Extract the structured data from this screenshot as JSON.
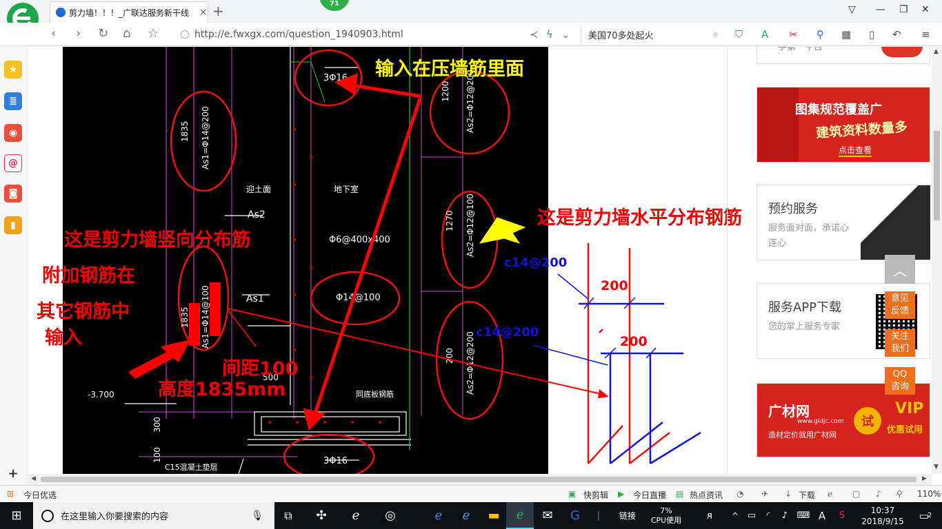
{
  "browser": {
    "tab_title": "剪力墙！！！_广联达服务新干线",
    "tab_close": "×",
    "new_tab": "+",
    "badge_count": "71",
    "url": "http://e.fwxgx.com/question_1940903.html",
    "search_text": "美国70多处起火",
    "accent_color": "#19a94a"
  },
  "cad": {
    "labels": {
      "top_3phi16": "3Φ16",
      "bottom_3phi16": "3Φ16",
      "as2_1200": "1200",
      "as2_phi12_top": "As2=Φ12@200",
      "as2_1270": "1270",
      "as2_phi12_mid": "As2=Φ12@100",
      "as2_200": "200",
      "as2_phi12_bot": "As2=Φ12@200",
      "as1_1835_top": "1835",
      "as1_phi14_top": "As1=Φ14@200",
      "as1_1835_bot": "1835",
      "as1_phi14_bot": "As1=Φ14@100",
      "yingtu": "迎土面",
      "dixiashi": "地下室",
      "as2_label": "As2",
      "as1_label": "As1",
      "phi6": "Φ6@400x400",
      "phi14_100": "Φ14@100",
      "elev": "-3.700",
      "dim_500": "500",
      "dim_300": "300",
      "dim_100": "100",
      "tongdi": "同底板钢筋",
      "c15": "C15混凝土垫层"
    }
  },
  "annotations": {
    "input_press_wall": "输入在压墙筋里面",
    "horizontal_rebar": "这是剪力墙水平分布钢筋",
    "vertical_rebar": "这是剪力墙竖向分布筋",
    "extra_rebar_1": "附加钢筋在",
    "extra_rebar_2": "其它钢筋中",
    "extra_rebar_3": "输入",
    "spacing": "间距100",
    "height": "高度1835mm",
    "c14_top": "c14@200",
    "c14_bot": "c14@200",
    "dim_200_top": "200",
    "dim_200_bot": "200"
  },
  "right_panel": {
    "top_partial": "手第一平台",
    "banner1_line1": "图集规范覆盖广",
    "banner1_line2": "建筑资料数量多",
    "banner1_btn": "点击查看",
    "card2_title": "预约服务",
    "card2_desc": "服务面对面，承诺心连心",
    "card3_title": "服务APP下载",
    "card3_desc": "您的掌上服务专家",
    "float_feedback": "意见反馈",
    "float_follow": "关注我们",
    "float_qq": "QQ咨询",
    "banner2_brand": "广材网",
    "banner2_site": "www.gldjc.com",
    "banner2_tag": "造材定价就用广材网",
    "banner2_try": "试",
    "banner2_vip": "VIP",
    "banner2_vip_sub": "优惠试用"
  },
  "statusbar": {
    "left": "今日优选",
    "kuaijianji": "快剪辑",
    "zhibo": "今日直播",
    "redian": "热点资讯",
    "download": "下载",
    "zoom": "110%"
  },
  "taskbar": {
    "search_placeholder": "在这里输入你要搜索的内容",
    "link": "链接",
    "cpu_value": "7%",
    "cpu_label": "CPU使用",
    "ime": "A",
    "time": "10:37",
    "date": "2018/9/15",
    "notifications": "2"
  }
}
